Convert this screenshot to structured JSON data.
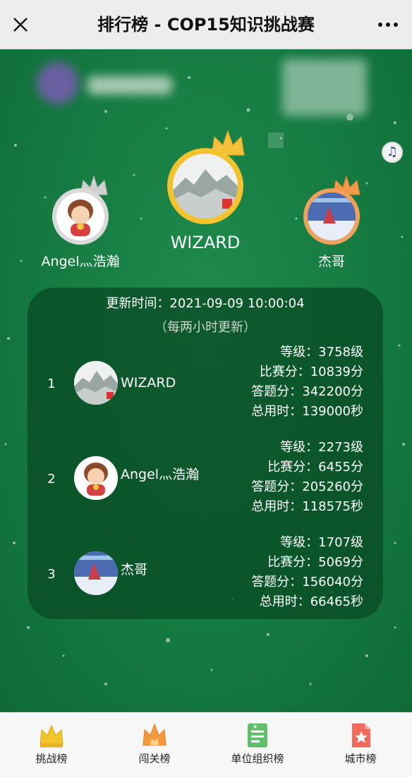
{
  "header": {
    "title": "排行榜 - COP15知识挑战赛",
    "close_icon": "close-icon",
    "more_icon": "more-icon"
  },
  "podium": {
    "first": {
      "name": "WIZARD",
      "ring_color": "#f3c32e",
      "crown_color": "#f5c03a"
    },
    "second": {
      "name": "Angel灬浩瀚",
      "ring_color": "#d9d9d9",
      "crown_color": "#d0d0d0"
    },
    "third": {
      "name": "杰哥",
      "ring_color": "#f0a25b",
      "crown_color": "#f29a4a"
    }
  },
  "panel": {
    "update_time": "更新时间：2021-09-09 10:00:04",
    "update_note": "（每两小时更新）"
  },
  "rankings": [
    {
      "rank": "1",
      "name": "WIZARD",
      "level": "等级：3758级",
      "match_score": "比赛分：10839分",
      "answer_score": "答题分：342200分",
      "total_time": "总用时：139000秒"
    },
    {
      "rank": "2",
      "name": "Angel灬浩瀚",
      "level": "等级：2273级",
      "match_score": "比赛分：6455分",
      "answer_score": "答题分：205260分",
      "total_time": "总用时：118575秒"
    },
    {
      "rank": "3",
      "name": "杰哥",
      "level": "等级：1707级",
      "match_score": "比赛分：5069分",
      "answer_score": "答题分：156040分",
      "total_time": "总用时：66465秒"
    }
  ],
  "tabs": [
    {
      "label": "挑战榜",
      "icon": "crown-icon"
    },
    {
      "label": "闯关榜",
      "icon": "orange-crown-icon"
    },
    {
      "label": "单位组织榜",
      "icon": "organization-icon"
    },
    {
      "label": "城市榜",
      "icon": "city-icon"
    }
  ],
  "colors": {
    "background_green": "#1e7a45",
    "panel": "#084622",
    "topbar": "#ededed"
  }
}
